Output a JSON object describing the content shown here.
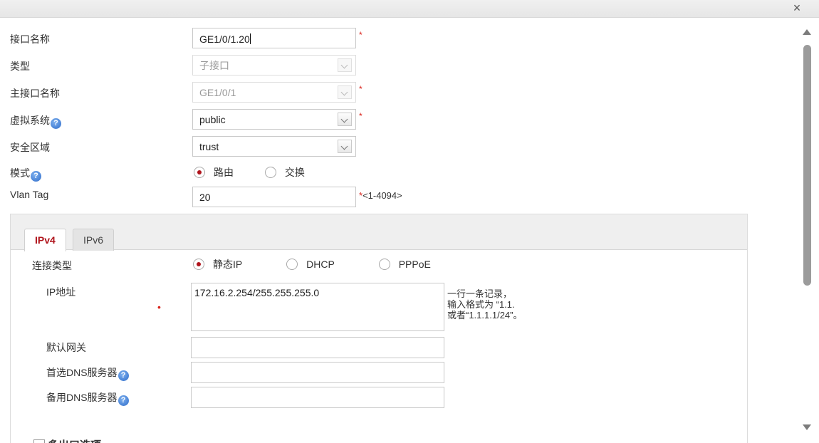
{
  "dialog": {
    "close_glyph": "×"
  },
  "form": {
    "interface_name": {
      "label": "接口名称",
      "value": "GE1/0/1.20",
      "required": "*"
    },
    "type": {
      "label": "类型",
      "value": "子接口"
    },
    "parent_interface": {
      "label": "主接口名称",
      "value": "GE1/0/1",
      "required": "*"
    },
    "virtual_system": {
      "label": "虚拟系统",
      "value": "public",
      "required": "*"
    },
    "security_zone": {
      "label": "安全区域",
      "value": "trust"
    },
    "mode": {
      "label": "模式",
      "options": [
        "路由",
        "交换"
      ],
      "selected": "路由"
    },
    "vlan_tag": {
      "label": "Vlan Tag",
      "value": "20",
      "required": "*",
      "range": "<1-4094>"
    }
  },
  "help_glyph": "?",
  "tabs": [
    {
      "label": "IPv4",
      "active": true
    },
    {
      "label": "IPv6",
      "active": false
    }
  ],
  "ipv4": {
    "connection_type": {
      "label": "连接类型",
      "options": [
        "静态IP",
        "DHCP",
        "PPPoE"
      ],
      "selected": "静态IP"
    },
    "ip_address": {
      "label": "IP地址",
      "required_dot": "•",
      "value": "172.16.2.254/255.255.255.0",
      "hint_lines": [
        "一行一条记录，",
        "输入格式为 “1.1.",
        "或者“1.1.1.1/24”。"
      ]
    },
    "default_gateway": {
      "label": "默认网关",
      "value": ""
    },
    "primary_dns": {
      "label": "首选DNS服务器",
      "value": ""
    },
    "secondary_dns": {
      "label": "备用DNS服务器",
      "value": ""
    },
    "multi_egress": {
      "label": "多出口选项",
      "checked": false
    }
  },
  "colors": {
    "accent": "#b0141c",
    "required": "#d9251d",
    "help": "#2f6cc9"
  }
}
